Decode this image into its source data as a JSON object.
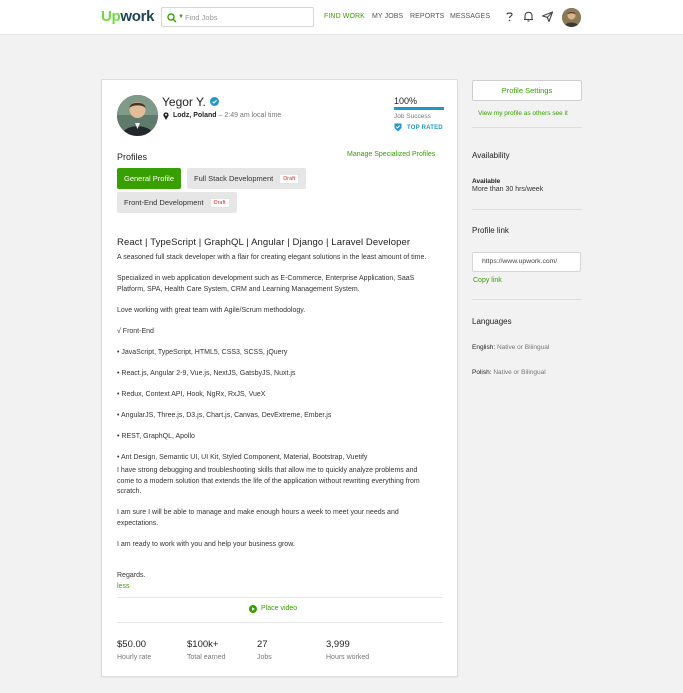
{
  "header": {
    "logo_up": "Up",
    "logo_work": "work",
    "search_placeholder": "Find Jobs",
    "nav": [
      "FIND WORK",
      "MY JOBS",
      "REPORTS",
      "MESSAGES"
    ],
    "icons": [
      "help-icon",
      "notifications-bell-icon",
      "send-icon",
      "user-avatar"
    ]
  },
  "profile": {
    "name": "Yegor Y.",
    "location": "Lodz, Poland",
    "local_time": "2:49 am local time",
    "job_success_pct": "100%",
    "job_success_value": 1.0,
    "job_success_label": "Job Success",
    "top_rated": "TOP RATED",
    "profiles_heading": "Profiles",
    "manage_link": "Manage Specialized Profiles",
    "tabs": [
      {
        "label": "General Profile",
        "draft": ""
      },
      {
        "label": "Full Stack Development",
        "draft": "Draft"
      },
      {
        "label": "Front-End Development",
        "draft": "Draft"
      }
    ],
    "headline": "React | TypeScript | GraphQL | Angular | Django | Laravel Developer",
    "description": [
      "A seasoned full stack developer with a flair for creating elegant solutions in the least amount of time.",
      "Specialized in web application development such as E-Commerce, Enterprise Application, SaaS Platform, SPA, Health Care System, CRM and Learning Management System.",
      "Love working with great team with Agile/Scrum methodology.",
      "√ Front-End",
      "• JavaScript, TypeScript, HTML5, CSS3, SCSS, jQuery",
      "• React.js, Angular 2-9, Vue.js, NextJS, GatsbyJS, Nuxt.js",
      "• Redux, Context API, Hook, NgRx, RxJS, VueX",
      "• AngularJS, Three.js, D3.js, Chart.js, Canvas, DevExtreme, Ember.js",
      "• REST, GraphQL, Apollo",
      "• Ant Design, Semantic UI, UI Kit, Styled Component, Material, Bootstrap, Vuetify"
    ],
    "description_2": [
      "I have strong debugging and troubleshooting skills that allow me to quickly analyze problems and come to a modern solution that extends the life of the application without rewriting everything from scratch.",
      "I am sure I will be able to manage and make enough hours a week to meet your needs and expectations.",
      "I am ready to work with you and help your business grow."
    ],
    "regards": "Regards.",
    "less_link": "less",
    "place_video": "Place video",
    "stats": [
      {
        "value": "$50.00",
        "label": "Hourly rate"
      },
      {
        "value": "$100k+",
        "label": "Total earned"
      },
      {
        "value": "27",
        "label": "Jobs"
      },
      {
        "value": "3,999",
        "label": "Hours worked"
      }
    ]
  },
  "sidebar": {
    "settings_button": "Profile Settings",
    "view_link": "View my profile as others see it",
    "availability_heading": "Availability",
    "availability_status": "Available",
    "availability_hours": "More than 30 hrs/week",
    "profile_link_heading": "Profile link",
    "profile_url": "https://www.upwork.com/",
    "copy_link": "Copy link",
    "languages_heading": "Languages",
    "languages": [
      {
        "name": "English:",
        "level": "Native or Bilingual"
      },
      {
        "name": "Polish:",
        "level": "Native or Bilingual"
      }
    ]
  },
  "colors": {
    "brand_green": "#37a000",
    "logo_green": "#6fda44",
    "logo_dark": "#1d4354",
    "info_blue": "#1f98c9"
  }
}
